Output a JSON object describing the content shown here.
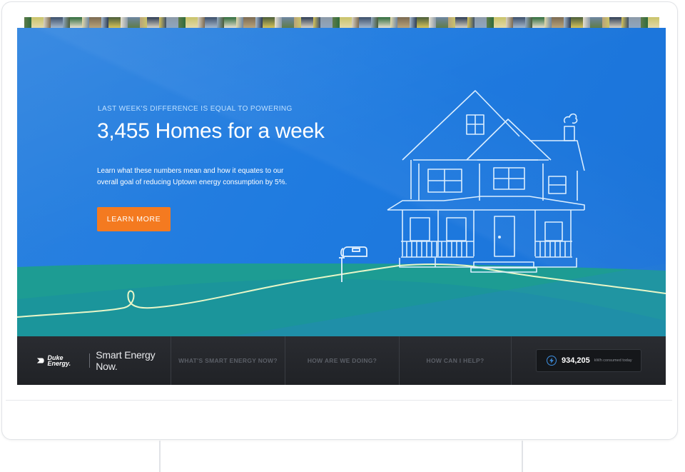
{
  "hero": {
    "kicker": "LAST WEEK'S DIFFERENCE IS EQUAL TO POWERING",
    "headline": "3,455 Homes for a week",
    "description": "Learn what these numbers mean and how it equates to our overall goal of reducing Uptown energy consumption by 5%.",
    "cta_label": "LEARN MORE"
  },
  "nav": {
    "logo_text": "Duke Energy.",
    "brand_name": "Smart Energy Now.",
    "items": [
      {
        "label": "WHAT'S SMART ENERGY NOW?"
      },
      {
        "label": "HOW ARE WE DOING?"
      },
      {
        "label": "HOW CAN I HELP?"
      }
    ],
    "counter": {
      "value": "934,205",
      "label": "kWh consumed today"
    }
  },
  "colors": {
    "accent_orange": "#f47a20",
    "sky_blue": "#1f7be0",
    "grass_teal": "#1a9a94",
    "navbar_dark": "#24262a"
  },
  "icons": {
    "logo": "duke-energy-logo-icon",
    "counter": "lightning-bolt-icon",
    "house": "house-illustration-icon",
    "mailbox": "mailbox-icon"
  }
}
